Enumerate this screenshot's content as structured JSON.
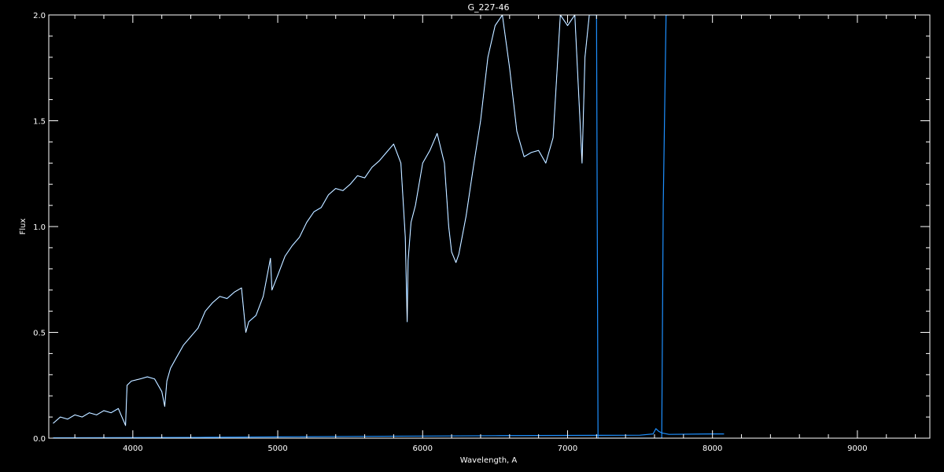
{
  "chart_data": {
    "type": "line",
    "title": "G_227-46",
    "xlabel": "Wavelength, A",
    "ylabel": "Flux",
    "xlim": [
      3420,
      9500
    ],
    "ylim": [
      0.0,
      2.0
    ],
    "xticks": [
      4000,
      5000,
      6000,
      7000,
      8000,
      9000
    ],
    "xtick_labels": [
      "4000",
      "5000",
      "6000",
      "7000",
      "8000",
      "9000"
    ],
    "yticks": [
      0.0,
      0.5,
      1.0,
      1.5,
      2.0
    ],
    "ytick_labels": [
      "0.0",
      "0.5",
      "1.0",
      "1.5",
      "2.0"
    ],
    "grid": false,
    "legend": "none",
    "colors": {
      "background": "#000000",
      "axes": "#ffffff",
      "spectrum": "#1e90ff",
      "model": "#ffffff"
    },
    "series": [
      {
        "color": "#1e90ff",
        "x": [
          3450,
          3500,
          3550,
          3600,
          3650,
          3700,
          3750,
          3800,
          3850,
          3900,
          3950,
          3960,
          3990,
          4050,
          4100,
          4150,
          4200,
          4220,
          4235,
          4260,
          4300,
          4350,
          4400,
          4450,
          4500,
          4550,
          4600,
          4650,
          4700,
          4750,
          4780,
          4800,
          4850,
          4900,
          4950,
          4960,
          5000,
          5050,
          5100,
          5150,
          5200,
          5250,
          5300,
          5350,
          5400,
          5450,
          5500,
          5550,
          5600,
          5650,
          5700,
          5750,
          5800,
          5850,
          5880,
          5893,
          5900,
          5920,
          5950,
          6000,
          6050,
          6100,
          6150,
          6180,
          6200,
          6230,
          6250,
          6300,
          6350,
          6400,
          6450,
          6500,
          6550,
          6600,
          6650,
          6700,
          6750,
          6800,
          6850,
          6900,
          6950,
          7000,
          7050,
          7100,
          7120,
          7150,
          7200,
          7210,
          7600,
          7650,
          7660,
          7680,
          7700
        ],
        "y": [
          0.07,
          0.1,
          0.09,
          0.11,
          0.1,
          0.12,
          0.11,
          0.13,
          0.12,
          0.14,
          0.06,
          0.25,
          0.27,
          0.28,
          0.29,
          0.28,
          0.22,
          0.15,
          0.27,
          0.33,
          0.38,
          0.44,
          0.48,
          0.52,
          0.6,
          0.64,
          0.67,
          0.66,
          0.69,
          0.71,
          0.5,
          0.55,
          0.58,
          0.67,
          0.85,
          0.7,
          0.77,
          0.86,
          0.91,
          0.95,
          1.02,
          1.07,
          1.09,
          1.15,
          1.18,
          1.17,
          1.2,
          1.24,
          1.23,
          1.28,
          1.31,
          1.35,
          1.39,
          1.3,
          0.95,
          0.55,
          0.84,
          1.02,
          1.1,
          1.3,
          1.36,
          1.44,
          1.3,
          1.0,
          0.88,
          0.83,
          0.87,
          1.05,
          1.28,
          1.5,
          1.8,
          1.95,
          2.0,
          1.75,
          1.45,
          1.33,
          1.35,
          1.36,
          1.3,
          1.42,
          2.0,
          1.95,
          2.0,
          1.3,
          1.8,
          2.0,
          2.0,
          0.0,
          0.0,
          0.0,
          1.1,
          2.0,
          2.0
        ]
      },
      {
        "color": "#ffffff",
        "x": [
          3450,
          3500,
          3550,
          3600,
          3650,
          3700,
          3750,
          3800,
          3850,
          3900,
          3950,
          3960,
          3990,
          4050,
          4100,
          4150,
          4200,
          4220,
          4235,
          4260,
          4300,
          4350,
          4400,
          4450,
          4500,
          4550,
          4600,
          4650,
          4700,
          4750,
          4780,
          4800,
          4850,
          4900,
          4950,
          4960,
          5000,
          5050,
          5100,
          5150,
          5200,
          5250,
          5300,
          5350,
          5400,
          5450,
          5500,
          5550,
          5600,
          5650,
          5700,
          5750,
          5800,
          5850,
          5880,
          5893,
          5900,
          5920,
          5950,
          6000,
          6050,
          6100,
          6150,
          6180,
          6200,
          6230,
          6250,
          6300,
          6350,
          6400,
          6450,
          6500,
          6550,
          6600,
          6650,
          6700,
          6750,
          6800,
          6850,
          6900,
          6950,
          7000,
          7050,
          7100,
          7120,
          7150,
          7200
        ],
        "y": [
          0.07,
          0.1,
          0.09,
          0.11,
          0.1,
          0.12,
          0.11,
          0.13,
          0.12,
          0.14,
          0.06,
          0.25,
          0.27,
          0.28,
          0.29,
          0.28,
          0.22,
          0.15,
          0.27,
          0.33,
          0.38,
          0.44,
          0.48,
          0.52,
          0.6,
          0.64,
          0.67,
          0.66,
          0.69,
          0.71,
          0.5,
          0.55,
          0.58,
          0.67,
          0.85,
          0.7,
          0.77,
          0.86,
          0.91,
          0.95,
          1.02,
          1.07,
          1.09,
          1.15,
          1.18,
          1.17,
          1.2,
          1.24,
          1.23,
          1.28,
          1.31,
          1.35,
          1.39,
          1.3,
          0.95,
          0.55,
          0.84,
          1.02,
          1.1,
          1.3,
          1.36,
          1.44,
          1.3,
          1.0,
          0.88,
          0.83,
          0.87,
          1.05,
          1.28,
          1.5,
          1.8,
          1.95,
          2.0,
          1.75,
          1.45,
          1.33,
          1.35,
          1.36,
          1.3,
          1.42,
          2.0,
          1.95,
          2.0,
          1.3,
          1.8,
          2.0,
          2.0
        ]
      },
      {
        "color": "#1e90ff",
        "x": [
          3450,
          4000,
          4500,
          5000,
          5500,
          6000,
          6500,
          7000,
          7500,
          7590,
          7610,
          7630,
          7650,
          7700,
          8000,
          8080
        ],
        "y": [
          0.002,
          0.003,
          0.004,
          0.006,
          0.008,
          0.01,
          0.012,
          0.013,
          0.014,
          0.02,
          0.045,
          0.032,
          0.025,
          0.018,
          0.02,
          0.02
        ]
      }
    ]
  }
}
